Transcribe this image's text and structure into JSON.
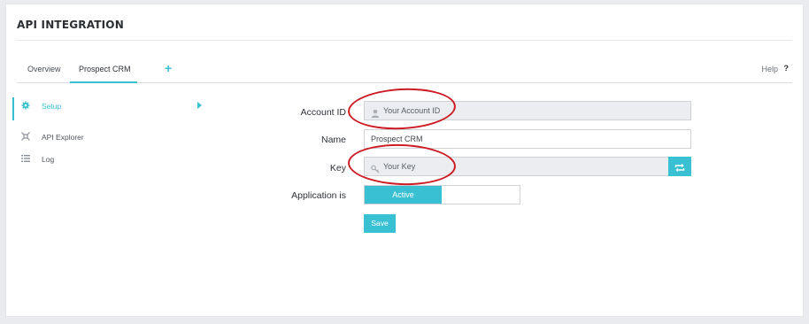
{
  "page": {
    "title": "API INTEGRATION"
  },
  "tabs": [
    {
      "label": "Overview"
    },
    {
      "label": "Prospect CRM",
      "active": true
    }
  ],
  "tab_add_label": "+",
  "help": {
    "label": "Help",
    "mark": "?"
  },
  "sidebar": {
    "items": [
      {
        "label": "Setup",
        "icon": "gear-icon",
        "active": true
      },
      {
        "label": "API Explorer",
        "icon": "api-explorer-icon"
      },
      {
        "label": "Log",
        "icon": "list-icon"
      }
    ]
  },
  "form": {
    "account_id": {
      "label": "Account ID",
      "placeholder": "Your Account ID",
      "icon": "user-icon"
    },
    "name": {
      "label": "Name",
      "value": "Prospect CRM"
    },
    "key": {
      "label": "Key",
      "placeholder": "Your Key",
      "icon": "key-icon",
      "refresh_icon": "refresh-icon"
    },
    "application": {
      "label": "Application is",
      "active_label": "Active",
      "state": "active"
    },
    "save_label": "Save"
  },
  "colors": {
    "accent": "#39c0d3",
    "annotation": "#cc1c24"
  }
}
